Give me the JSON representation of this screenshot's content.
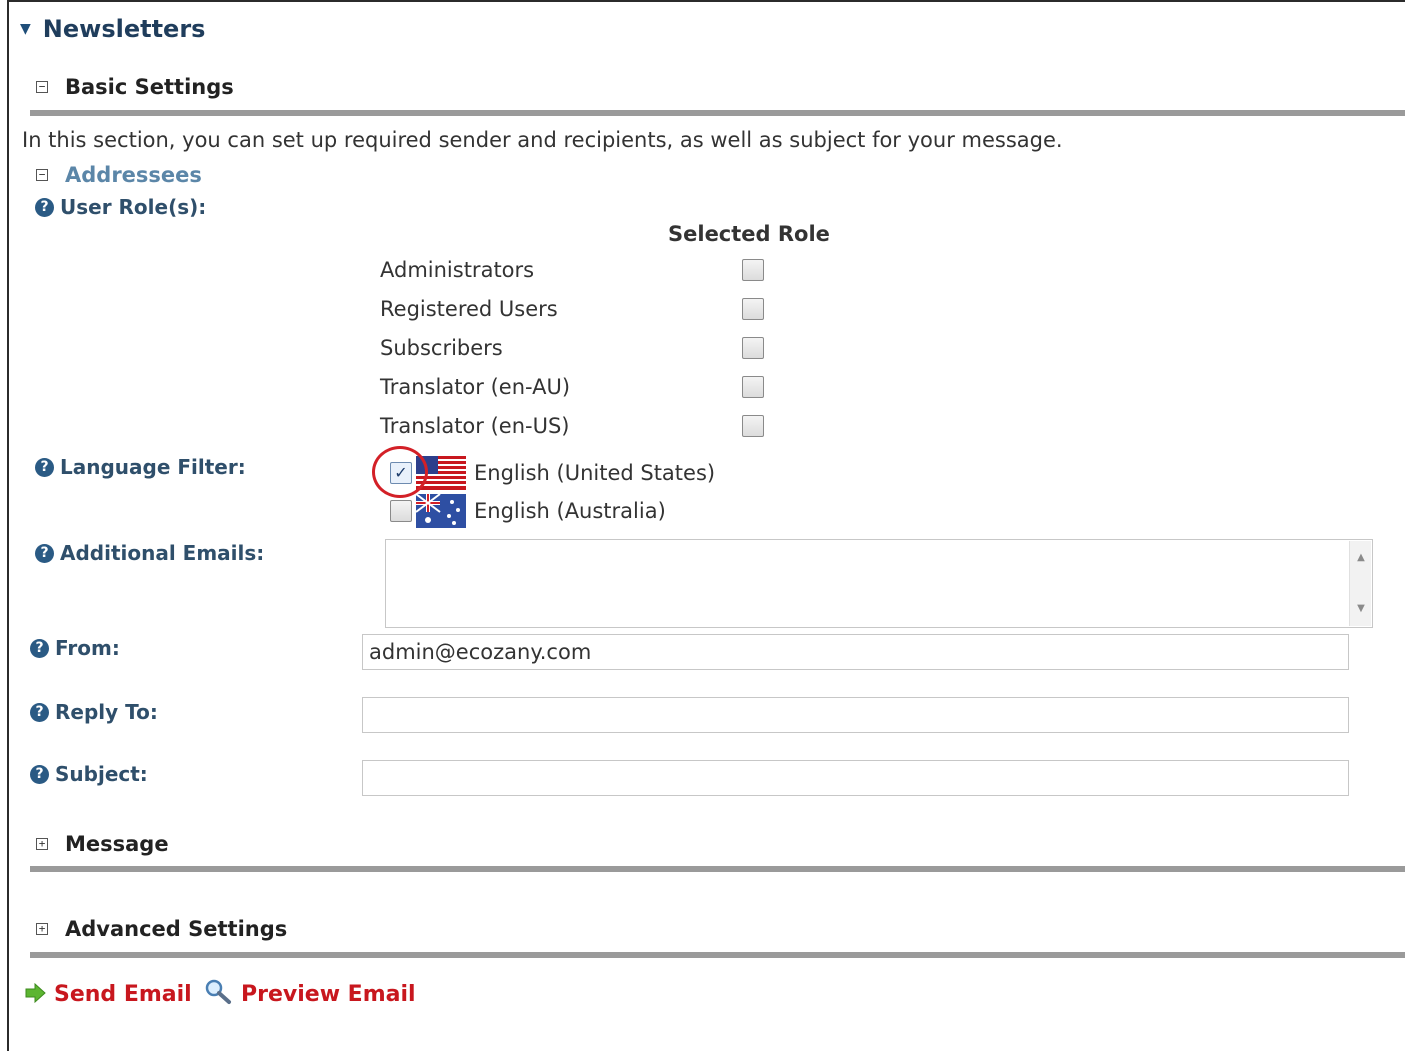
{
  "header": {
    "title": "Newsletters"
  },
  "basic_settings": {
    "title": "Basic Settings",
    "intro": "In this section, you can set up required sender and recipients, as well as subject for your message.",
    "addressees": {
      "title": "Addressees",
      "user_roles_label": "User Role(s):",
      "roles_column_header": "Selected Role",
      "roles": [
        {
          "name": "Administrators",
          "selected": false
        },
        {
          "name": "Registered Users",
          "selected": false
        },
        {
          "name": "Subscribers",
          "selected": false
        },
        {
          "name": "Translator (en-AU)",
          "selected": false
        },
        {
          "name": "Translator (en-US)",
          "selected": false
        }
      ]
    },
    "language_filter": {
      "label": "Language Filter:",
      "options": [
        {
          "name": "English (United States)",
          "checked": true,
          "flag": "us-flag-icon"
        },
        {
          "name": "English (Australia)",
          "checked": false,
          "flag": "au-flag-icon"
        }
      ]
    },
    "additional_emails": {
      "label": "Additional Emails:",
      "value": ""
    },
    "from": {
      "label": "From:",
      "value": "admin@ecozany.com"
    },
    "reply_to": {
      "label": "Reply To:",
      "value": ""
    },
    "subject": {
      "label": "Subject:",
      "value": ""
    }
  },
  "message_section": {
    "title": "Message"
  },
  "advanced_section": {
    "title": "Advanced Settings"
  },
  "actions": {
    "send_label": "Send Email",
    "preview_label": "Preview Email"
  },
  "colors": {
    "accent_red": "#c8171e",
    "heading_blue": "#1f3d5c",
    "link_blue": "#5b86a8",
    "rule_gray": "#9a9a9a"
  },
  "icons": {
    "collapse": "collapse-icon",
    "expand": "expand-icon",
    "help": "help-icon",
    "send": "arrow-right-icon",
    "preview": "magnifier-icon"
  }
}
